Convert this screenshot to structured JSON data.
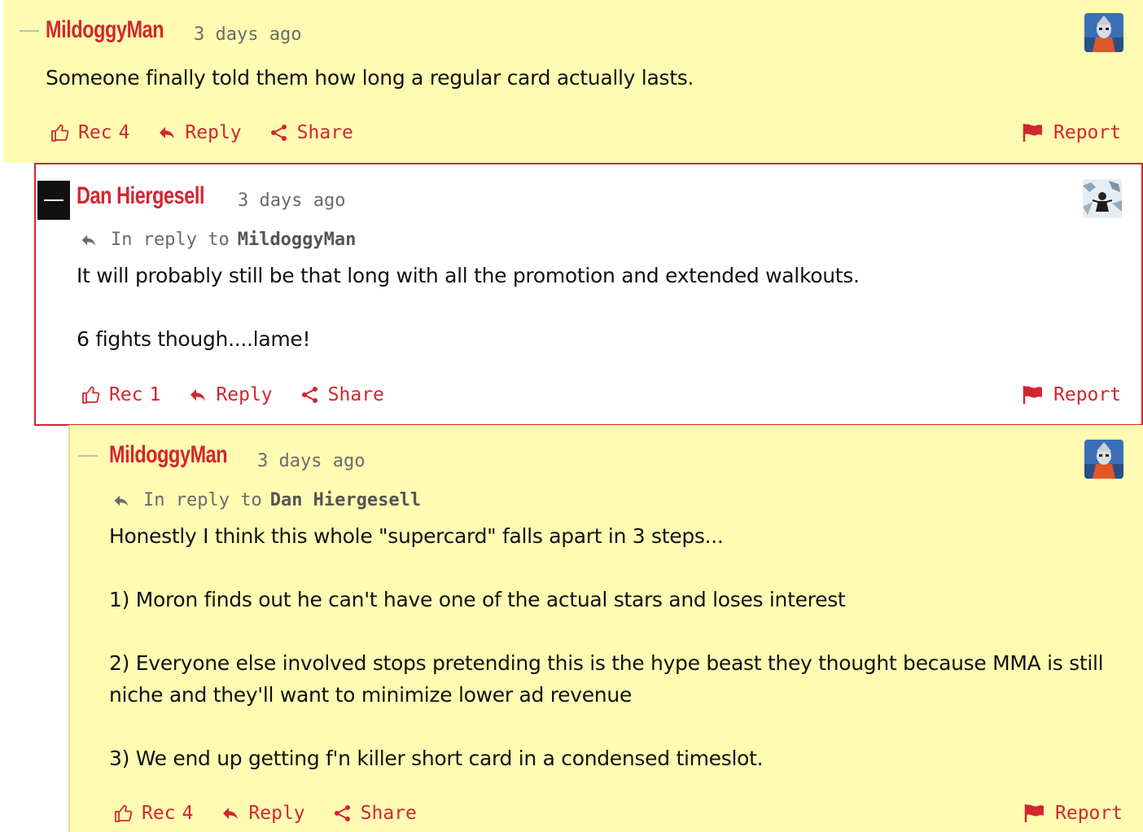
{
  "theme": {
    "accent": "#d22630",
    "highlight_bg": "#fffbb3",
    "muted": "#6b6b6b"
  },
  "comments": [
    {
      "author": "MildoggyMan",
      "time": "3 days ago",
      "avatar": "robot-avatar",
      "body": [
        "Someone finally told them how long a regular card actually lasts."
      ],
      "rec_label": "Rec",
      "rec_count": "4",
      "reply_label": "Reply",
      "share_label": "Share",
      "report_label": "Report"
    },
    {
      "author": "Dan Hiergesell",
      "time": "3 days ago",
      "avatar": "person-snow-avatar",
      "in_reply_prefix": "In reply to",
      "in_reply_name": "MildoggyMan",
      "body": [
        "It will probably still be that long with all the promotion and extended walkouts.",
        "",
        "6 fights though....lame!"
      ],
      "rec_label": "Rec",
      "rec_count": "1",
      "reply_label": "Reply",
      "share_label": "Share",
      "report_label": "Report"
    },
    {
      "author": "MildoggyMan",
      "time": "3 days ago",
      "avatar": "robot-avatar",
      "in_reply_prefix": "In reply to",
      "in_reply_name": "Dan Hiergesell",
      "body": [
        "Honestly I think this whole \"supercard\" falls apart in 3 steps...",
        "",
        "1) Moron finds out he can't have one of the actual stars and loses interest",
        "",
        "2) Everyone else involved stops pretending this is the hype beast they thought because MMA is still niche and they'll want to minimize lower ad revenue",
        "",
        "3) We end up getting f'n killer short card in a condensed timeslot."
      ],
      "rec_label": "Rec",
      "rec_count": "4",
      "reply_label": "Reply",
      "share_label": "Share",
      "report_label": "Report"
    }
  ]
}
